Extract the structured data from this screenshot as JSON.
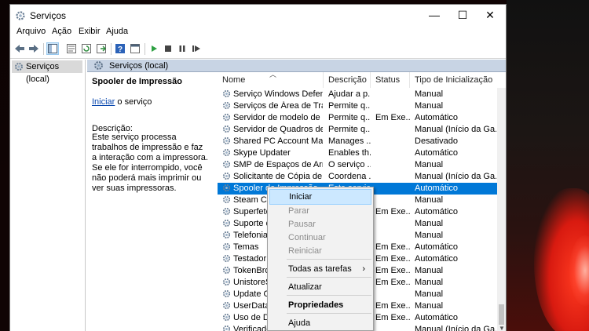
{
  "window": {
    "title": "Serviços"
  },
  "window_controls": {
    "minimize": "—",
    "maximize": "☐",
    "close": "✕"
  },
  "menu": [
    "Arquivo",
    "Ação",
    "Exibir",
    "Ajuda"
  ],
  "tree": {
    "root": "Serviços (local)"
  },
  "panel": {
    "header": "Serviços (local)",
    "selected_title": "Spooler de Impressão",
    "link_text": "Iniciar",
    "link_suffix": " o serviço",
    "description_label": "Descrição:",
    "description": "Este serviço processa trabalhos de impressão e faz a interação com a impressora. Se ele for interrompido, você não poderá mais imprimir ou ver suas impressoras."
  },
  "columns": {
    "name": "Nome",
    "description": "Descrição",
    "status": "Status",
    "startup": "Tipo de Inicialização"
  },
  "services": [
    {
      "name": "Serviço Windows Defender ...",
      "description": "Ajudar a p...",
      "status": "",
      "startup": "Manual"
    },
    {
      "name": "Serviços de Área de Trabalh...",
      "description": "Permite q...",
      "status": "",
      "startup": "Manual"
    },
    {
      "name": "Servidor de modelo de Dad...",
      "description": "Permite q...",
      "status": "Em Exe...",
      "startup": "Automático"
    },
    {
      "name": "Servidor de Quadros de Câ...",
      "description": "Permite q...",
      "status": "",
      "startup": "Manual (Início da Ga..."
    },
    {
      "name": "Shared PC Account Manager",
      "description": "Manages ...",
      "status": "",
      "startup": "Desativado"
    },
    {
      "name": "Skype Updater",
      "description": "Enables th...",
      "status": "",
      "startup": "Automático"
    },
    {
      "name": "SMP de Espaços de Armaze...",
      "description": "O serviço ...",
      "status": "",
      "startup": "Manual"
    },
    {
      "name": "Solicitante de Cópia de So...",
      "description": "Coordena ...",
      "status": "",
      "startup": "Manual (Início da Ga..."
    },
    {
      "name": "Spooler de Impressão",
      "description": "Este serviç...",
      "status": "",
      "startup": "Automático"
    },
    {
      "name": "Steam Clie",
      "description": "",
      "status": "",
      "startup": "Manual"
    },
    {
      "name": "Superfetch",
      "description": "",
      "status": "Em Exe...",
      "startup": "Automático"
    },
    {
      "name": "Suporte de",
      "description": "",
      "status": "",
      "startup": "Manual"
    },
    {
      "name": "Telefonia",
      "description": "",
      "status": "",
      "startup": "Manual"
    },
    {
      "name": "Temas",
      "description": "",
      "status": "Em Exe...",
      "startup": "Automático"
    },
    {
      "name": "Testador d",
      "description": "",
      "status": "Em Exe...",
      "startup": "Automático"
    },
    {
      "name": "TokenBrok",
      "description": "",
      "status": "Em Exe...",
      "startup": "Manual"
    },
    {
      "name": "UnistoreSv",
      "description": "",
      "status": "Em Exe...",
      "startup": "Manual"
    },
    {
      "name": "Update Or",
      "description": "",
      "status": "",
      "startup": "Manual"
    },
    {
      "name": "UserDataS",
      "description": "",
      "status": "Em Exe...",
      "startup": "Manual"
    },
    {
      "name": "Uso de Da",
      "description": "",
      "status": "Em Exe...",
      "startup": "Automático"
    },
    {
      "name": "Verificador",
      "description": "",
      "status": "",
      "startup": "Manual (Início da Ga..."
    }
  ],
  "selected_index": 8,
  "context_menu": {
    "iniciar": "Iniciar",
    "parar": "Parar",
    "pausar": "Pausar",
    "continuar": "Continuar",
    "reiniciar": "Reiniciar",
    "todas_tarefas": "Todas as tarefas",
    "atualizar": "Atualizar",
    "propriedades": "Propriedades",
    "ajuda": "Ajuda"
  },
  "colors": {
    "selection": "#0078d7",
    "panel_header": "#c8d4e4",
    "link": "#0645ad"
  }
}
